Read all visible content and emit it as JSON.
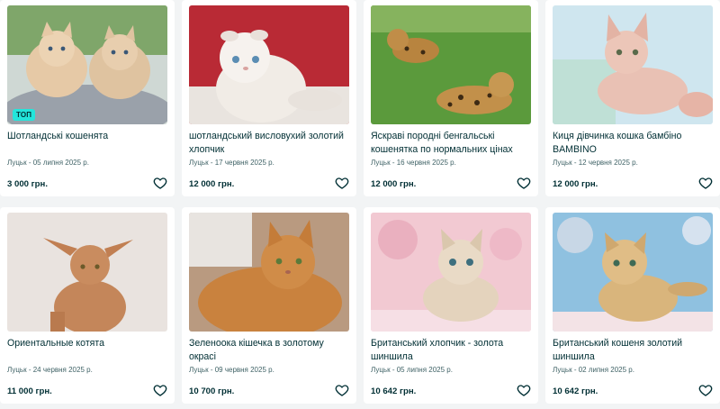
{
  "listings": [
    {
      "title": "Шотландські кошенята",
      "meta": "Луцьк - 05 липня 2025 р.",
      "price": "3 000 грн.",
      "badge": "ТОП",
      "photo_bg": "#cfd8d4",
      "cat_color": "#e6c9a6"
    },
    {
      "title": "шотландський висловухий золотий хлопчик",
      "meta": "Луцьк - 17 червня 2025 р.",
      "price": "12 000 грн.",
      "badge": "",
      "photo_bg": "#b92a35",
      "cat_color": "#f1ece6"
    },
    {
      "title": "Яскраві породні бенгальські кошенятка по нормальних цінах",
      "meta": "Луцьк - 16 червня 2025 р.",
      "price": "12 000 грн.",
      "badge": "",
      "photo_bg": "#5b9a3c",
      "cat_color": "#b8843f"
    },
    {
      "title": "Киця дівчинка кошка бамбіно BAMBINO",
      "meta": "Луцьк - 12 червня 2025 р.",
      "price": "12 000 грн.",
      "badge": "",
      "photo_bg": "#cfe6ef",
      "cat_color": "#e9c1b4"
    },
    {
      "title": "Ориентальные котята",
      "meta": "Луцьк - 24 червня 2025 р.",
      "price": "11 000 грн.",
      "badge": "",
      "photo_bg": "#e9e3df",
      "cat_color": "#c4865a"
    },
    {
      "title": "Зеленоока кішечка в золотому окрасі",
      "meta": "Луцьк - 09 червня 2025 р.",
      "price": "10 700 грн.",
      "badge": "",
      "photo_bg": "#b99a80",
      "cat_color": "#c9823e"
    },
    {
      "title": "Британський хлопчик - золота шиншила",
      "meta": "Луцьк - 05 липня 2025 р.",
      "price": "10 642 грн.",
      "badge": "",
      "photo_bg": "#f2c9d2",
      "cat_color": "#e4d3bd"
    },
    {
      "title": "Британський кошеня золотий шиншила",
      "meta": "Луцьк - 02 липня 2025 р.",
      "price": "10 642 грн.",
      "badge": "",
      "photo_bg": "#8fc1e0",
      "cat_color": "#d9b57c"
    }
  ],
  "icons": {
    "favorite": "heart-outline-icon"
  },
  "colors": {
    "text": "#002f34",
    "muted": "#406367",
    "badge": "#23e5db",
    "background": "#f2f4f5"
  }
}
